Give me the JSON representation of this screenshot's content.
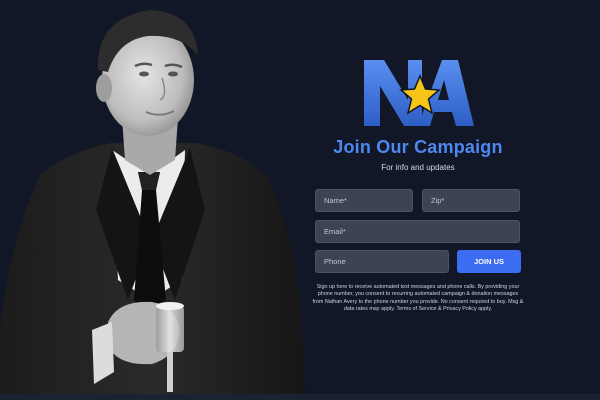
{
  "colors": {
    "background": "#111726",
    "accent": "#3c6cf2",
    "title": "#4f87f0",
    "logo_blue": "#3b6fd0",
    "logo_star": "#f5c518",
    "field_bg": "#3b4354"
  },
  "logo": {
    "text": "NA",
    "icon": "star-icon"
  },
  "form": {
    "title": "Join Our Campaign",
    "subtitle": "For info and updates",
    "name_placeholder": "Name*",
    "zip_placeholder": "Zip*",
    "email_placeholder": "Email*",
    "phone_placeholder": "Phone",
    "submit_label": "JOIN US",
    "disclaimer": "Sign up here to receive automated text messages and phone calls. By providing your phone number, you consent to recurring automated campaign & donation messages from Nathan Avery to the phone number you provide. No consent required to buy. Msg & data rates may apply. Terms of Service & Privacy Policy apply."
  }
}
